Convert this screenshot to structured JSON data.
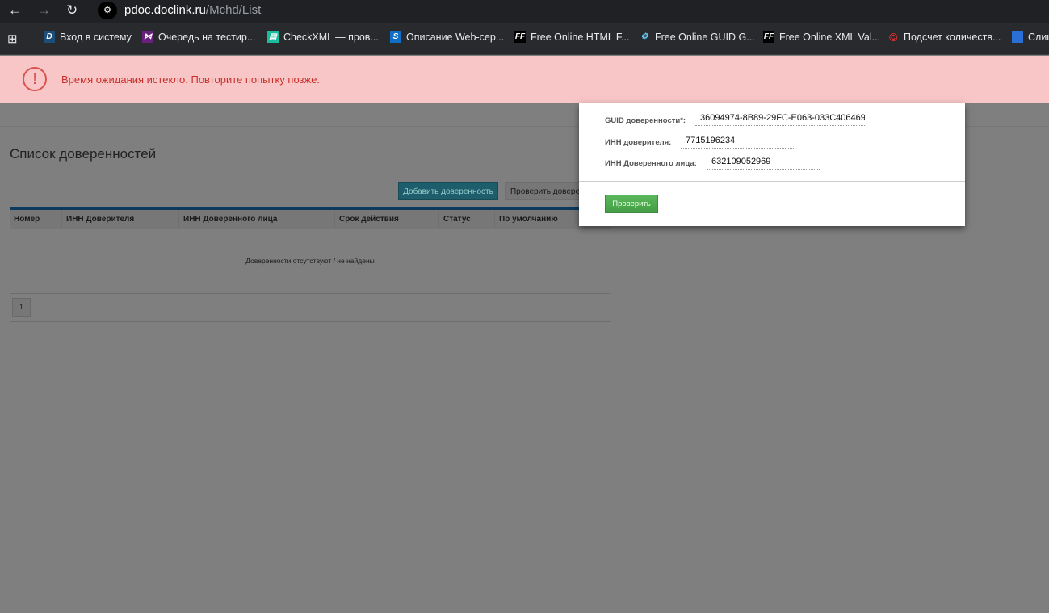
{
  "browser": {
    "url_host": "pdoc.doclink.ru",
    "url_path": "/Mchd/List",
    "bookmarks": [
      {
        "label": "Вход в систему",
        "icon": "D"
      },
      {
        "label": "Очередь на тестир...",
        "icon": "VS"
      },
      {
        "label": "CheckXML — пров...",
        "icon": "doc"
      },
      {
        "label": "Описание Web-сер...",
        "icon": "S"
      },
      {
        "label": "Free Online HTML F...",
        "icon": "FF"
      },
      {
        "label": "Free Online GUID G...",
        "icon": "gears"
      },
      {
        "label": "Free Online XML Val...",
        "icon": "FF"
      },
      {
        "label": "Подсчет количеств...",
        "icon": "C"
      },
      {
        "label": "Слиц",
        "icon": "book"
      }
    ]
  },
  "alert": {
    "message": "Время ожидания истекло. Повторите попытку позже.",
    "color": "#d9534f"
  },
  "page": {
    "title": "Список доверенностей",
    "add_button": "Добавить доверенность",
    "check_button": "Проверить довере",
    "columns": [
      "Номер",
      "ИНН Доверителя",
      "ИНН Доверенного лица",
      "Срок действия",
      "Статус",
      "По умолчанию"
    ],
    "empty_text": "Доверенности отсутствуют / не найдены",
    "pages": [
      "1"
    ]
  },
  "modal": {
    "guid_label": "GUID доверенности*:",
    "guid_value": "36094974-8B89-29FC-E063-033C406469",
    "principal_inn_label": "ИНН доверителя:",
    "principal_inn_value": "7715196234",
    "agent_inn_label": "ИНН Доверенного лица:",
    "agent_inn_value": "632109052969",
    "submit": "Проверить"
  }
}
